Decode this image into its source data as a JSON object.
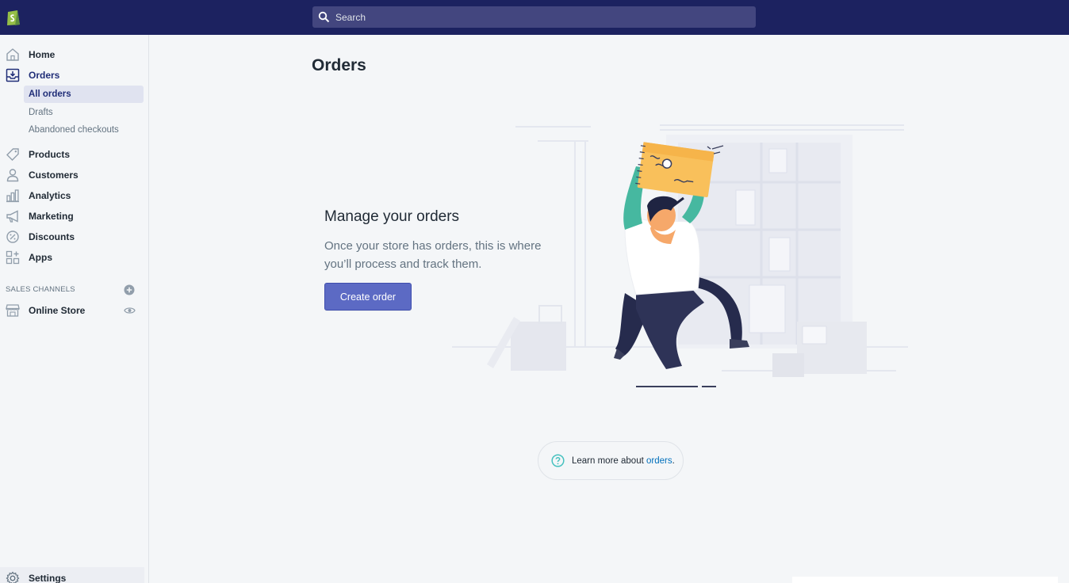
{
  "topbar": {
    "logo_icon": "shopify-bag-icon",
    "search": {
      "icon": "search-icon",
      "placeholder": "Search"
    }
  },
  "sidebar": {
    "items": [
      {
        "label": "Home",
        "icon": "home-icon"
      },
      {
        "label": "Orders",
        "icon": "orders-inbox-icon",
        "active": true
      },
      {
        "label": "Products",
        "icon": "tag-icon"
      },
      {
        "label": "Customers",
        "icon": "person-icon"
      },
      {
        "label": "Analytics",
        "icon": "bar-chart-icon"
      },
      {
        "label": "Marketing",
        "icon": "megaphone-icon"
      },
      {
        "label": "Discounts",
        "icon": "discount-icon"
      },
      {
        "label": "Apps",
        "icon": "apps-icon"
      }
    ],
    "orders_sub": [
      {
        "label": "All orders",
        "selected": true
      },
      {
        "label": "Drafts"
      },
      {
        "label": "Abandoned checkouts"
      }
    ],
    "sales_channels": {
      "title": "SALES CHANNELS",
      "add_icon": "plus-circle-icon",
      "items": [
        {
          "label": "Online Store",
          "icon": "store-icon",
          "action_icon": "eye-icon"
        }
      ]
    },
    "settings": {
      "label": "Settings",
      "icon": "gear-icon"
    }
  },
  "main": {
    "title": "Orders",
    "empty_state": {
      "heading": "Manage your orders",
      "text": "Once your store has orders, this is where you’ll process and track them.",
      "button": "Create order"
    },
    "help": {
      "icon": "question-circle-icon",
      "text": "Learn more about ",
      "link": "orders",
      "suffix": "."
    }
  },
  "colors": {
    "topbar": "#1c2260",
    "search_bg": "#43467f",
    "primary": "#5c6ac4",
    "active_nav": "#202e78",
    "link": "#006fbb"
  }
}
